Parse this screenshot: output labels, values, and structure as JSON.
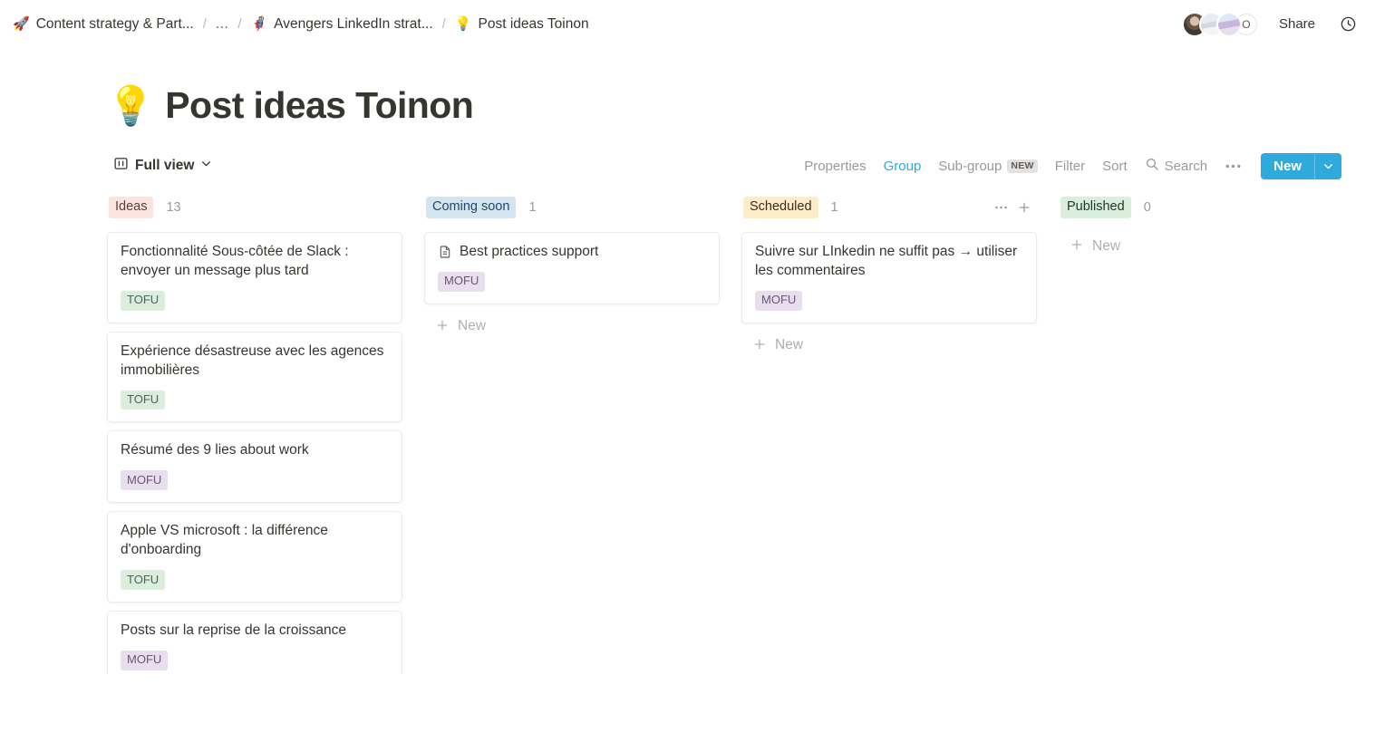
{
  "breadcrumb": {
    "items": [
      {
        "emoji": "🚀",
        "label": "Content strategy & Part...",
        "icon_name": "rocket-emoji"
      },
      {
        "emoji": "",
        "label": "...",
        "icon_name": "ellipsis-crumb"
      },
      {
        "emoji": "🦸",
        "label": "Avengers LinkedIn strat...",
        "icon_name": "superhero-emoji"
      },
      {
        "emoji": "💡",
        "label": "Post ideas Toinon",
        "icon_name": "lightbulb-emoji"
      }
    ],
    "separator": "/"
  },
  "topbar": {
    "avatar_overflow_label": "O",
    "share_label": "Share",
    "history_icon": "clock-icon"
  },
  "page": {
    "emoji": "💡",
    "title": "Post ideas Toinon"
  },
  "toolbar": {
    "view_label": "Full view",
    "view_icon": "board-view-icon",
    "items": [
      {
        "label": "Properties",
        "active": false
      },
      {
        "label": "Group",
        "active": true
      },
      {
        "label": "Sub-group",
        "active": false,
        "badge": "NEW"
      },
      {
        "label": "Filter",
        "active": false
      },
      {
        "label": "Sort",
        "active": false
      },
      {
        "label": "Search",
        "active": false,
        "icon": "search-icon"
      }
    ],
    "more_label": "•••",
    "new_label": "New",
    "new_caret_icon": "chevron-down-icon",
    "accent_color": "#2eaadc"
  },
  "board": {
    "add_new_label": "New",
    "columns": [
      {
        "name": "Ideas",
        "count": "13",
        "chip_bg": "#fbe4e0",
        "chip_color": "#5d3f3a",
        "show_actions": false,
        "show_add_new": false,
        "cards": [
          {
            "title": "Fonctionnalité Sous-côtée de Slack : envoyer un message plus tard",
            "tag": "TOFU",
            "tag_type": "tofu",
            "has_page_icon": false
          },
          {
            "title": "Expérience désastreuse avec les agences immobilières",
            "tag": "TOFU",
            "tag_type": "tofu",
            "has_page_icon": false
          },
          {
            "title": "Résumé des 9 lies about work",
            "tag": "MOFU",
            "tag_type": "mofu",
            "has_page_icon": false
          },
          {
            "title": "Apple VS microsoft : la différence d'onboarding",
            "tag": "TOFU",
            "tag_type": "tofu",
            "has_page_icon": false
          },
          {
            "title": "Posts sur la reprise de la croissance",
            "tag": "MOFU",
            "tag_type": "mofu",
            "has_page_icon": false
          }
        ]
      },
      {
        "name": "Coming soon",
        "count": "1",
        "chip_bg": "#d3e5ef",
        "chip_color": "#28456c",
        "show_actions": false,
        "show_add_new": true,
        "cards": [
          {
            "title": "Best practices support",
            "tag": "MOFU",
            "tag_type": "mofu",
            "has_page_icon": true
          }
        ]
      },
      {
        "name": "Scheduled",
        "count": "1",
        "chip_bg": "#fdecc8",
        "chip_color": "#402c1b",
        "show_actions": true,
        "show_add_new": true,
        "cards": [
          {
            "title": "Suivre sur LInkedin ne suffit pas → utiliser les commentaires",
            "tag": "MOFU",
            "tag_type": "mofu",
            "has_page_icon": false
          }
        ]
      },
      {
        "name": "Published",
        "count": "0",
        "chip_bg": "#dbeddb",
        "chip_color": "#1c3829",
        "show_actions": false,
        "show_add_new": true,
        "cards": []
      }
    ]
  }
}
